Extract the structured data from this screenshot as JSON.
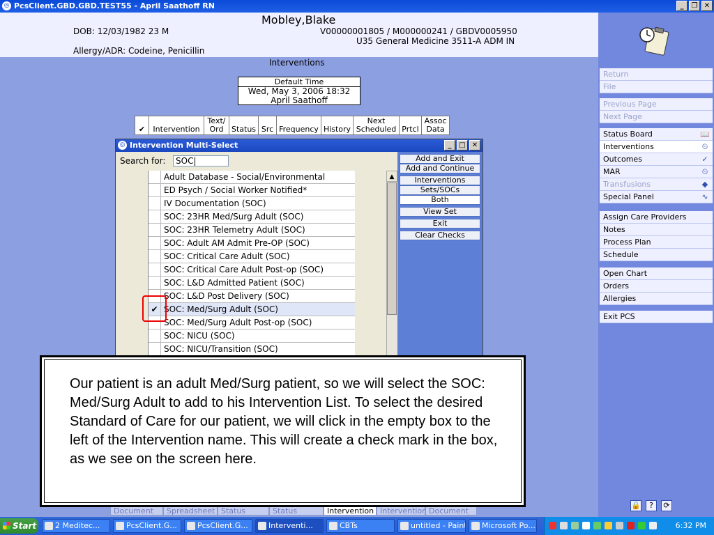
{
  "window": {
    "title": "PcsClient.GBD.GBD.TEST55 - April Saathoff RN"
  },
  "patient": {
    "name": "Mobley,Blake",
    "dob": "DOB: 12/03/1982 23 M",
    "ids": "V00000001805 / M000000241 / GBDV0005950",
    "location": "U35 General Medicine  3511-A  ADM IN",
    "allergy": "Allergy/ADR: Codeine, Penicillin"
  },
  "page_title": "Interventions",
  "default_time": {
    "label": "Default Time",
    "datetime": "Wed, May 3, 2006  18:32",
    "user": "April Saathoff"
  },
  "columns": [
    {
      "label": "✔",
      "w": 21
    },
    {
      "label": "Intervention",
      "w": 79
    },
    {
      "label": "Text/ Ord",
      "w": 36
    },
    {
      "label": "Status",
      "w": 42
    },
    {
      "label": "Src",
      "w": 26
    },
    {
      "label": "Frequency",
      "w": 64
    },
    {
      "label": "History",
      "w": 46
    },
    {
      "label": "Next Scheduled",
      "w": 66
    },
    {
      "label": "Prtcl",
      "w": 32
    },
    {
      "label": "Assoc Data",
      "w": 40
    }
  ],
  "dialog": {
    "title": "Intervention Multi-Select",
    "search_label": "Search for:",
    "search_value": "SOC|",
    "items": [
      {
        "label": "Adult Database - Social/Environmental",
        "checked": ""
      },
      {
        "label": "ED Psych / Social Worker Notified*",
        "checked": ""
      },
      {
        "label": "IV Documentation (SOC)",
        "checked": ""
      },
      {
        "label": "SOC: 23HR Med/Surg Adult (SOC)",
        "checked": ""
      },
      {
        "label": "SOC: 23HR Telemetry Adult (SOC)",
        "checked": ""
      },
      {
        "label": "SOC: Adult AM Admit Pre-OP (SOC)",
        "checked": ""
      },
      {
        "label": "SOC: Critical Care Adult (SOC)",
        "checked": ""
      },
      {
        "label": "SOC: Critical Care Adult Post-op (SOC)",
        "checked": ""
      },
      {
        "label": "SOC: L&D Admitted Patient (SOC)",
        "checked": ""
      },
      {
        "label": "SOC: L&D Post Delivery (SOC)",
        "checked": ""
      },
      {
        "label": "SOC: Med/Surg Adult (SOC)",
        "checked": "✔"
      },
      {
        "label": "SOC: Med/Surg Adult Post-op (SOC)",
        "checked": ""
      },
      {
        "label": "SOC: NICU (SOC)",
        "checked": ""
      },
      {
        "label": "SOC: NICU/Transition (SOC)",
        "checked": ""
      }
    ],
    "buttons": {
      "add_exit": "Add and Exit",
      "add_continue": "Add and Continue",
      "interventions": "Interventions",
      "sets_socs": "Sets/SOCs",
      "both": "Both",
      "view_set": "View Set",
      "exit": "Exit",
      "clear_checks": "Clear Checks"
    }
  },
  "menu": {
    "group1": [
      "Return",
      "File"
    ],
    "group2": [
      "Previous Page",
      "Next Page"
    ],
    "group3": [
      {
        "label": "Status Board",
        "icon": "book-icon",
        "glyph": "📖"
      },
      {
        "label": "Interventions",
        "icon": "clock-icon",
        "glyph": "⏲"
      },
      {
        "label": "Outcomes",
        "icon": "checklist-icon",
        "glyph": "✓"
      },
      {
        "label": "MAR",
        "icon": "med-icon",
        "glyph": "⏲"
      },
      {
        "label": "Transfusions",
        "icon": "blood-bag-icon",
        "glyph": "◆"
      },
      {
        "label": "Special Panel",
        "icon": "pulse-icon",
        "glyph": "∿"
      }
    ],
    "group4": [
      "Assign Care Providers",
      "Notes",
      "Process Plan",
      "Schedule"
    ],
    "group5": [
      "Open Chart",
      "Orders",
      "Allergies"
    ],
    "group6": [
      "Exit PCS"
    ]
  },
  "bottom_tabs": [
    "Document",
    "Spreadsheet",
    "Status",
    "Status",
    "Intervention",
    "Intervention",
    "Document"
  ],
  "callout": "Our patient is an adult Med/Surg patient, so we will select the SOC: Med/Surg Adult to add to his Intervention List. To select the desired Standard of Care for our patient, we will click in the empty box to the left of the Intervention name. This will create a check mark in the box, as we see on the screen here.",
  "taskbar": {
    "start": "Start",
    "tasks": [
      "2 Meditec...",
      "PcsClient.G...",
      "PcsClient.G...",
      "Interventi...",
      "CBTs",
      "untitled - Paint",
      "Microsoft Po..."
    ],
    "time": "6:32 PM"
  },
  "colors": {
    "background": "#8c9fe0",
    "right_panel": "#7288de",
    "highlight": "#e00000"
  }
}
